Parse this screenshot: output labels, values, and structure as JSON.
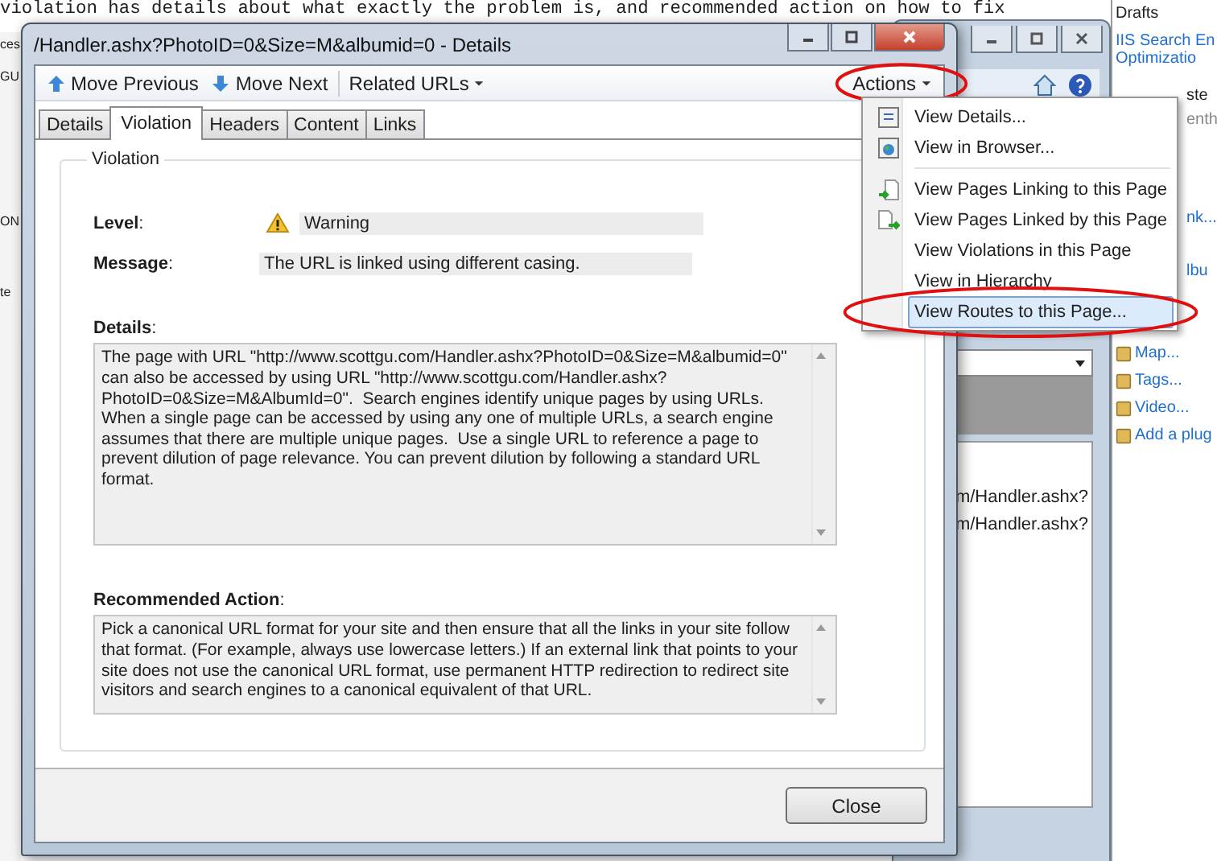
{
  "background": {
    "note": "violation has details about what exactly the problem is, and recommended action on how to fix",
    "left_fragments": [
      "ces",
      "GU",
      "ON",
      "te"
    ]
  },
  "side_panel": {
    "heading": "Drafts",
    "links": [
      "IIS Search En",
      "Optimizatio"
    ],
    "fragments": [
      "ste",
      "enth",
      "nk...",
      "lbu"
    ],
    "tools": [
      "Map...",
      "Tags...",
      "Video...",
      "Add a plug"
    ]
  },
  "back_window": {
    "rows": [
      "m/Handler.ashx?",
      "m/Handler.ashx?"
    ]
  },
  "dialog": {
    "title": "/Handler.ashx?PhotoID=0&Size=M&albumid=0 - Details",
    "toolbar": [
      {
        "label": "Move Previous",
        "kind": "up"
      },
      {
        "label": "Move Next",
        "kind": "down"
      },
      {
        "label": "Related URLs",
        "kind": "dropdown"
      }
    ],
    "actions": {
      "label": "Actions",
      "circled": true
    },
    "tabs": [
      {
        "label": "Details",
        "selected": false
      },
      {
        "label": "Violation",
        "selected": true
      },
      {
        "label": "Headers",
        "selected": false
      },
      {
        "label": "Content",
        "selected": false
      },
      {
        "label": "Links",
        "selected": false
      }
    ],
    "group_title": "Violation",
    "level": {
      "label": "**Level**:",
      "value": "Warning"
    },
    "message": {
      "label": "**Message**:",
      "value": "The URL is linked using different casing."
    },
    "details": {
      "label": "**Details**:",
      "text": "The page with URL \"http://www.scottgu.com/Handler.ashx?PhotoID=0&Size=M&albumid=0\" can also be accessed by using URL \"http://www.scottgu.com/Handler.ashx?PhotoID=0&Size=M&AlbumId=0\".  Search engines identify unique pages by using URLs.  When a single page can be accessed by using any one of multiple URLs, a search engine assumes that there are multiple unique pages.  Use a single URL to reference a page to prevent dilution of page relevance. You can prevent dilution by following a standard URL format."
    },
    "recommended": {
      "label": "**Recommended Action**:",
      "text": "Pick a canonical URL format for your site and then ensure that all the links in your site follow that format. (For example, always use lowercase letters.) If an external link that points to your site does not use the canonical URL format, use permanent HTTP redirection to redirect site visitors and search engines to a canonical equivalent of that URL."
    },
    "close_button": "Close"
  },
  "actions_menu": [
    {
      "label": "View Details...",
      "kind": "page",
      "selected": false,
      "circled": false
    },
    {
      "label": "View in Browser...",
      "kind": "globe",
      "selected": false,
      "circled": false
    },
    {
      "kind": "separator"
    },
    {
      "label": "View Pages Linking to this Page",
      "kind": "arrow-in",
      "selected": false,
      "circled": false
    },
    {
      "label": "View Pages Linked by this Page",
      "kind": "arrow-out",
      "selected": false,
      "circled": false
    },
    {
      "label": "View Violations in this Page",
      "kind": "plain",
      "selected": false,
      "circled": false
    },
    {
      "label": "View in Hierarchy",
      "kind": "plain",
      "selected": false,
      "circled": false
    },
    {
      "label": "View Routes to this Page...",
      "kind": "plain",
      "selected": true,
      "circled": true
    }
  ]
}
